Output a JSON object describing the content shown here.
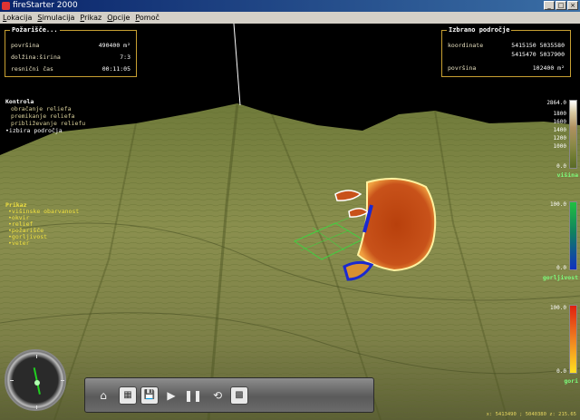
{
  "window": {
    "title": "fireStarter 2000",
    "buttons": [
      "_",
      "□",
      "×"
    ]
  },
  "menu": [
    "Lokacija",
    "Simulacija",
    "Prikaz",
    "Opcije",
    "Pomoč"
  ],
  "pozarisce": {
    "title": "Požarišče...",
    "rows": [
      {
        "label": "površina",
        "value": "490400 m²"
      },
      {
        "label": "dolžina:širina",
        "value": "7:3"
      },
      {
        "label": "resnični čas",
        "value": "00:11:05"
      }
    ]
  },
  "izbrano": {
    "title": "Izbrano področje",
    "coord_label": "koordinate",
    "coords": [
      "5415150 5035580",
      "5415470 5037900"
    ],
    "area_label": "površina",
    "area_value": "102400 m²"
  },
  "kontrola": {
    "title": "Kontrola",
    "items": [
      "obračanje reliefa",
      "premikanje reliefa",
      "približevanje reliefu",
      "izbira področja"
    ],
    "active_index": 3
  },
  "prikaz": {
    "title": "Prikaz",
    "items": [
      "višinske obarvanost",
      "okvir",
      "relief",
      "požarišče",
      "gorljivost",
      "veter"
    ]
  },
  "legend_visina": {
    "top": "2864.0",
    "ticks": [
      "1800",
      "1600",
      "1400",
      "1200",
      "1000"
    ],
    "bottom": "0.0",
    "caption": "višina"
  },
  "legend_gorljivost": {
    "top": "100.0",
    "bottom": "0.0",
    "caption": "gorljivost"
  },
  "legend_gori": {
    "top": "100.0",
    "bottom": "0.0",
    "caption": "gori"
  },
  "toolbar": {
    "buttons": [
      {
        "name": "home-view-button",
        "glyph": "⌂"
      },
      {
        "name": "map-button",
        "glyph": "▦"
      },
      {
        "name": "save-button",
        "glyph": "💾"
      },
      {
        "name": "play-button",
        "glyph": "▶"
      },
      {
        "name": "pause-button",
        "glyph": "❚❚"
      },
      {
        "name": "reset-button",
        "glyph": "⟲"
      },
      {
        "name": "grid-button",
        "glyph": "▩"
      }
    ]
  },
  "status": "x: 5413490 ; 5040380 z: 215.65",
  "colors": {
    "hud_border": "#c8a032",
    "fire": "#c0460e",
    "window_bar": "#0a246a"
  }
}
